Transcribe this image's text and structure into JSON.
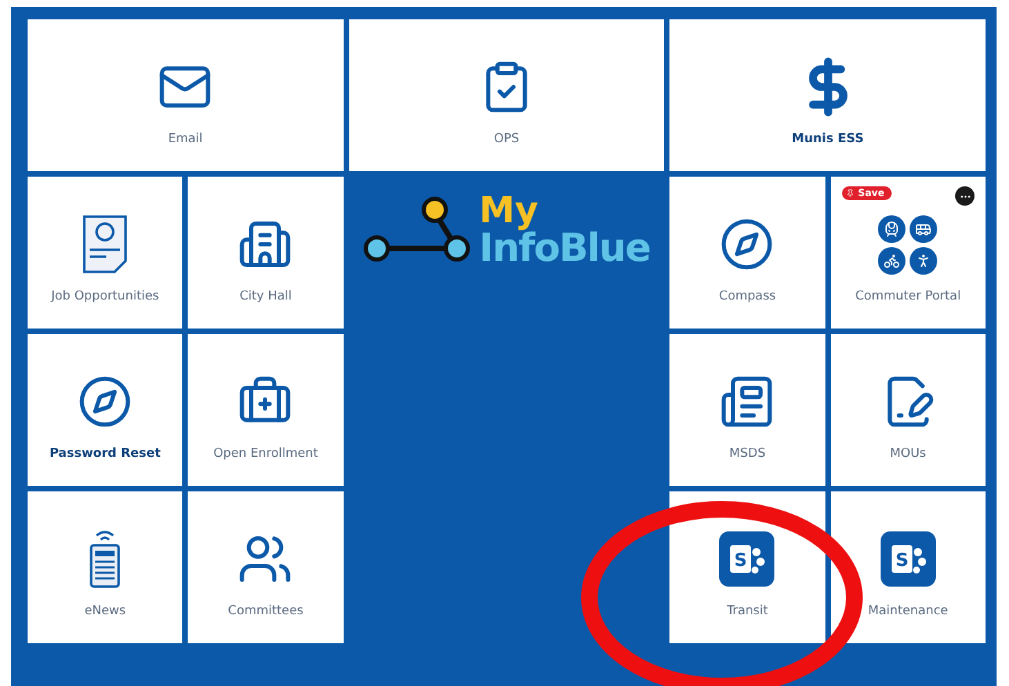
{
  "top_tiles": [
    {
      "label": "Email",
      "bold": false
    },
    {
      "label": "OPS",
      "bold": false
    },
    {
      "label": "Munis ESS",
      "bold": true
    }
  ],
  "left_tiles": [
    {
      "label": "Job Opportunities",
      "bold": false
    },
    {
      "label": "City Hall",
      "bold": false
    },
    {
      "label": "Password Reset",
      "bold": true
    },
    {
      "label": "Open Enrollment",
      "bold": false
    },
    {
      "label": "eNews",
      "bold": false
    },
    {
      "label": "Committees",
      "bold": false
    }
  ],
  "logo": {
    "line1": "My",
    "line2": "InfoBlue"
  },
  "save_badge": {
    "label": "Save"
  },
  "right_tiles": [
    {
      "label": "Compass",
      "bold": false
    },
    {
      "label": "Commuter Portal",
      "bold": false
    },
    {
      "label": "MSDS",
      "bold": false
    },
    {
      "label": "MOUs",
      "bold": false
    },
    {
      "label": "Transit",
      "bold": false,
      "icon_letter": "S"
    },
    {
      "label": "Maintenance",
      "bold": false,
      "icon_letter": "S"
    }
  ]
}
